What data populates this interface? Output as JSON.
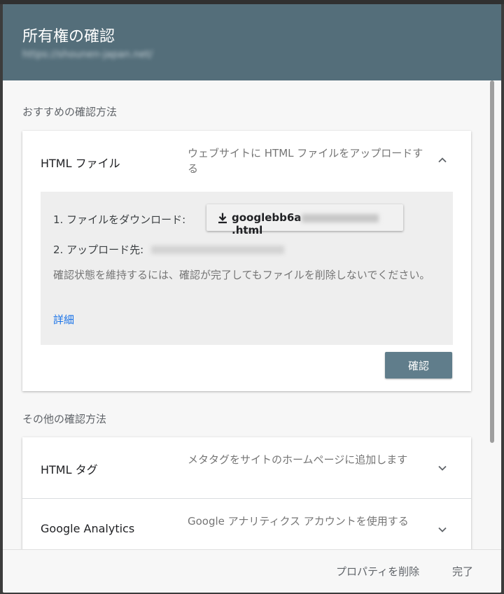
{
  "dialog": {
    "title": "所有権の確認",
    "subtitle": "https://shounen-japan.net/"
  },
  "recommended": {
    "section_label": "おすすめの確認方法",
    "method": {
      "name": "HTML ファイル",
      "description": "ウェブサイトに HTML ファイルをアップロードする",
      "expanded": true,
      "step1_label": "1. ファイルをダウンロード:",
      "download_file_prefix": "googlebb6a",
      "download_file_suffix": ".html",
      "step2_label": "2. アップロード先:",
      "note": "確認状態を維持するには、確認が完了してもファイルを削除しないでください。",
      "details_link": "詳細",
      "confirm_button": "確認"
    }
  },
  "other": {
    "section_label": "その他の確認方法",
    "methods": [
      {
        "name": "HTML タグ",
        "description": "メタタグをサイトのホームページに追加します"
      },
      {
        "name": "Google Analytics",
        "description": "Google アナリティクス アカウントを使用する"
      }
    ]
  },
  "footer": {
    "delete_property": "プロパティを削除",
    "done": "完了"
  },
  "colors": {
    "header": "#546e7a",
    "primary_button": "#607d8b",
    "link": "#1a73e8"
  },
  "icons": {
    "expanded_chevron": "chevron-up-icon",
    "collapsed_chevron": "chevron-down-icon",
    "download": "download-icon"
  }
}
